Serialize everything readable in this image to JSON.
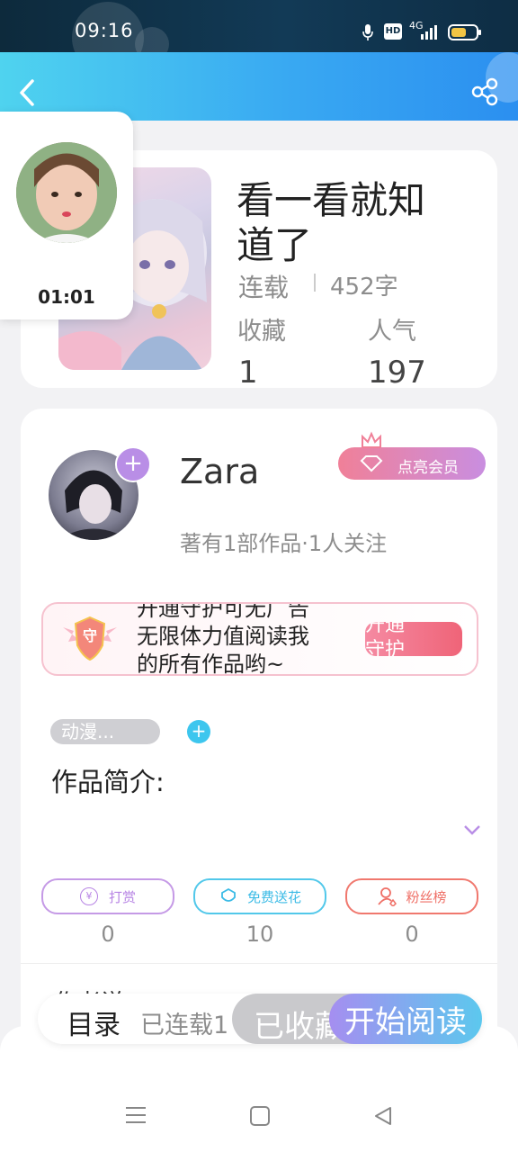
{
  "status": {
    "time": "09:16",
    "hd": "HD",
    "net": "4G"
  },
  "book": {
    "title_line1": "看一看就知",
    "title_line2": "道了",
    "status_label": "连载",
    "word_count": "452字",
    "favorites_label": "收藏",
    "popularity_label": "人气",
    "favorites_value": "1",
    "popularity_value": "197"
  },
  "video": {
    "time": "01:01"
  },
  "author": {
    "name": "Zara",
    "stats": "著有1部作品·1人关注",
    "vip_label": "点亮会员"
  },
  "guard": {
    "line1": "开通守护可无广告",
    "line2": "无限体力值阅读我",
    "line3": "的所有作品哟~",
    "badge_text": "守",
    "button_label": "开通守护"
  },
  "tags": {
    "tag1": "动漫..."
  },
  "intro": {
    "title": "作品简介:"
  },
  "actions": {
    "reward_label": "打赏",
    "reward_count": "0",
    "flower_label": "免费送花",
    "flower_count": "10",
    "fans_label": "粉丝榜",
    "fans_count": "0"
  },
  "next_section": {
    "title": "作者说"
  },
  "bottom_bar": {
    "catalog_label": "目录",
    "serial_label": "已连载1",
    "favorited_label": "已收藏",
    "read_label": "开始阅读"
  },
  "colors": {
    "header_start": "#4fd3ef",
    "header_end": "#2b8ff0",
    "vip_start": "#f08098",
    "vip_end": "#c98ee0",
    "reward": "#c59ae6",
    "flower": "#52c8ea",
    "fans": "#f0786e",
    "read_start": "#a58ef0",
    "read_end": "#5cc8ee"
  }
}
